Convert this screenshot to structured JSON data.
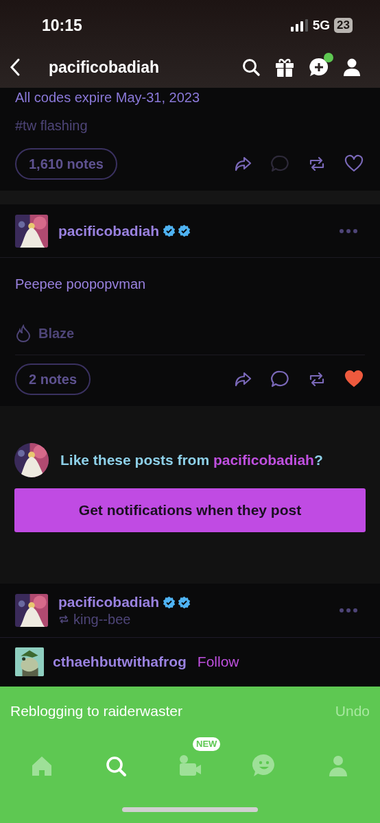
{
  "status_bar": {
    "time": "10:15",
    "network": "5G",
    "battery": "23"
  },
  "nav": {
    "title": "pacificobadiah",
    "has_notification": true
  },
  "posts": [
    {
      "kind": "tail",
      "body": "All codes expire May-31, 2023",
      "tag": "#tw flashing",
      "notes": "1,610 notes",
      "liked": false,
      "actions": [
        {
          "kind": "share",
          "disabled": false
        },
        {
          "kind": "reply",
          "disabled": true
        },
        {
          "kind": "reblog",
          "disabled": false
        },
        {
          "kind": "like",
          "disabled": false
        }
      ]
    },
    {
      "kind": "full",
      "author": "pacificobadiah",
      "verified": true,
      "body": "Peepee poopopvman",
      "blaze": "Blaze",
      "notes": "2 notes",
      "liked": true,
      "actions": [
        {
          "kind": "share",
          "disabled": false
        },
        {
          "kind": "reply",
          "disabled": false
        },
        {
          "kind": "reblog",
          "disabled": false
        },
        {
          "kind": "like",
          "disabled": false
        }
      ]
    }
  ],
  "suggestion": {
    "prompt_before": "Like these posts from ",
    "prompt_name": "pacificobadiah",
    "prompt_after": "?",
    "button": "Get notifications when they post"
  },
  "reblog_post": {
    "author": "pacificobadiah",
    "verified": true,
    "reblogged_from": "king--bee",
    "source_author": "cthaehbutwithafrog",
    "follow": "Follow"
  },
  "toast": {
    "message": "Reblogging to raiderwaster",
    "action": "Undo"
  },
  "tabs": [
    {
      "kind": "home",
      "selected": false
    },
    {
      "kind": "search",
      "selected": true
    },
    {
      "kind": "video",
      "selected": false,
      "badge": "NEW"
    },
    {
      "kind": "chat",
      "selected": false
    },
    {
      "kind": "account",
      "selected": false
    }
  ]
}
